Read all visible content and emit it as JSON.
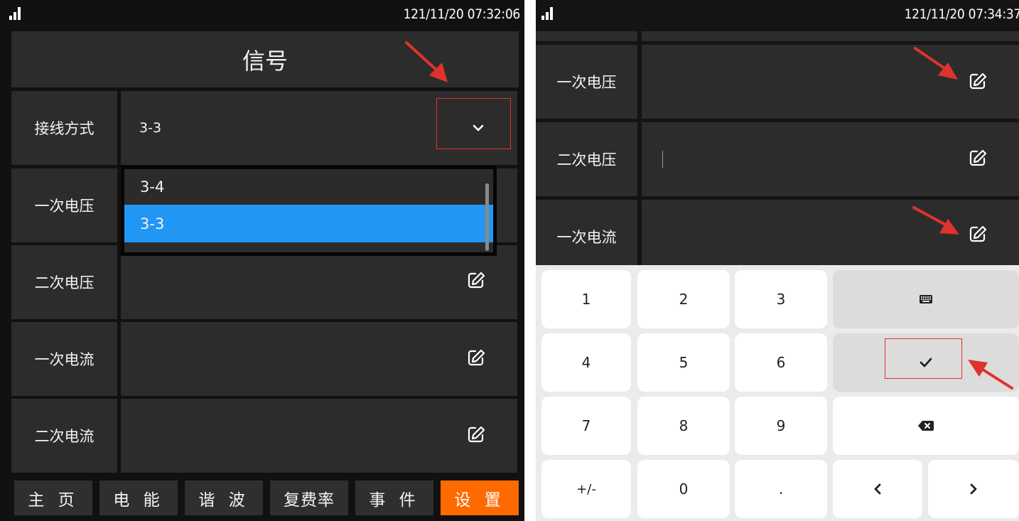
{
  "left": {
    "status": {
      "time": "121/11/20 07:32:06"
    },
    "title": "信号",
    "wiring": {
      "label": "接线方式",
      "value": "3-3"
    },
    "dropdown": {
      "options": [
        "3-4",
        "3-3"
      ],
      "selected": "3-3"
    },
    "rows": [
      {
        "label": "一次电压"
      },
      {
        "label": "二次电压"
      },
      {
        "label": "一次电流"
      },
      {
        "label": "二次电流"
      }
    ],
    "nav": [
      "主 页",
      "电 能",
      "谐 波",
      "复费率",
      "事 件",
      "设 置"
    ],
    "active_nav": "设 置"
  },
  "right": {
    "status": {
      "time": "121/11/20 07:34:37"
    },
    "rows": [
      {
        "label": "一次电压"
      },
      {
        "label": "二次电压"
      },
      {
        "label": "一次电流"
      }
    ],
    "keypad": {
      "row1": [
        "1",
        "2",
        "3"
      ],
      "row2": [
        "4",
        "5",
        "6"
      ],
      "row3": [
        "7",
        "8",
        "9"
      ],
      "row4": [
        "+/-",
        "0",
        "."
      ]
    }
  },
  "colors": {
    "accent": "#ff6a00",
    "selection": "#2196f3",
    "annotation": "#e0322d",
    "panel_bg": "#111111",
    "cell_bg": "#2c2c2c"
  }
}
